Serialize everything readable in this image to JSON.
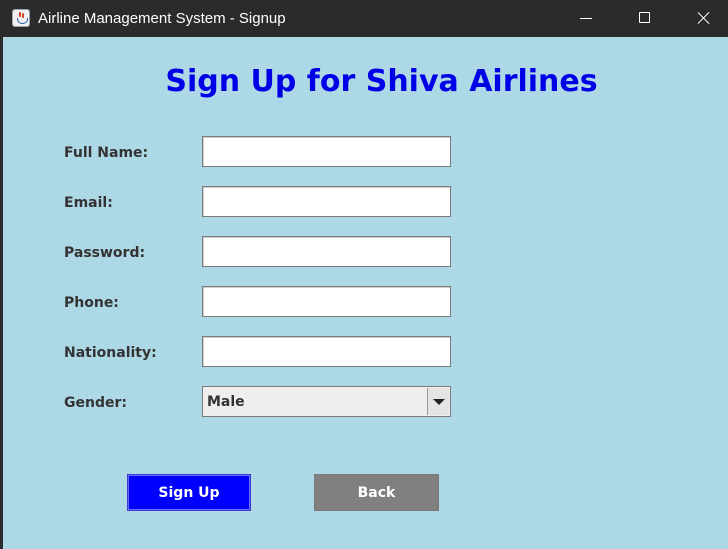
{
  "window": {
    "title": "Airline Management System - Signup",
    "icon": "java-coffee-icon"
  },
  "form": {
    "heading": "Sign Up for Shiva Airlines",
    "fields": [
      {
        "label": "Full Name:",
        "value": ""
      },
      {
        "label": "Email:",
        "value": ""
      },
      {
        "label": "Password:",
        "value": ""
      },
      {
        "label": "Phone:",
        "value": ""
      },
      {
        "label": "Nationality:",
        "value": ""
      }
    ],
    "gender": {
      "label": "Gender:",
      "selected": "Male"
    }
  },
  "buttons": {
    "signup": "Sign Up",
    "back": "Back"
  },
  "colors": {
    "background": "#add8e6",
    "heading": "#0000e6",
    "signup_button": "#0000ff",
    "back_button": "#808080"
  }
}
